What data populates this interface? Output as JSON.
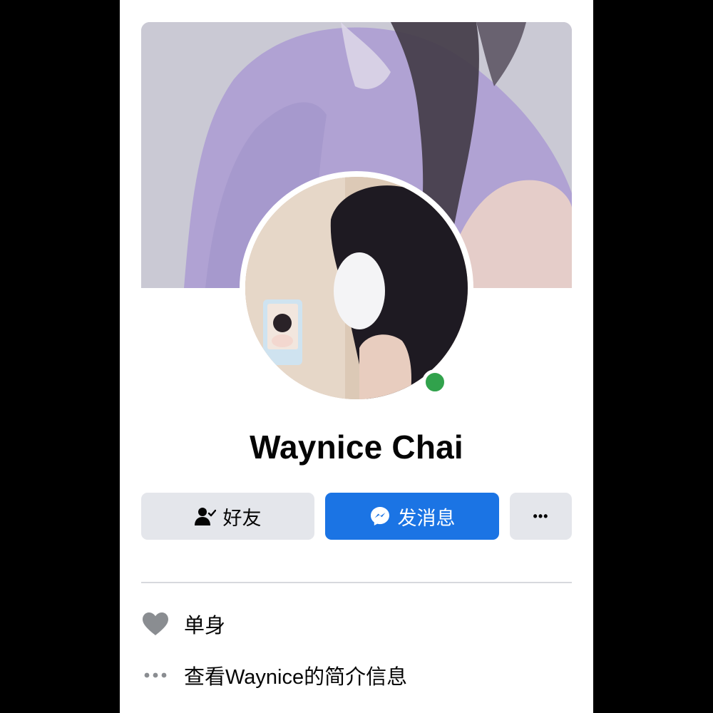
{
  "profile": {
    "name": "Waynice Chai",
    "online": true
  },
  "actions": {
    "friends_label": "好友",
    "message_label": "发消息",
    "more_label": "•••"
  },
  "about": {
    "relationship": "单身",
    "view_intro": "查看Waynice的简介信息"
  },
  "icons": {
    "friends": "person-check-icon",
    "message": "messenger-icon",
    "more": "more-icon",
    "relationship": "heart-icon",
    "intro": "ellipsis-icon"
  },
  "colors": {
    "primary_button": "#1b74e4",
    "secondary_button": "#e4e6eb",
    "online": "#31a24c",
    "icon_gray": "#8a8d91"
  }
}
